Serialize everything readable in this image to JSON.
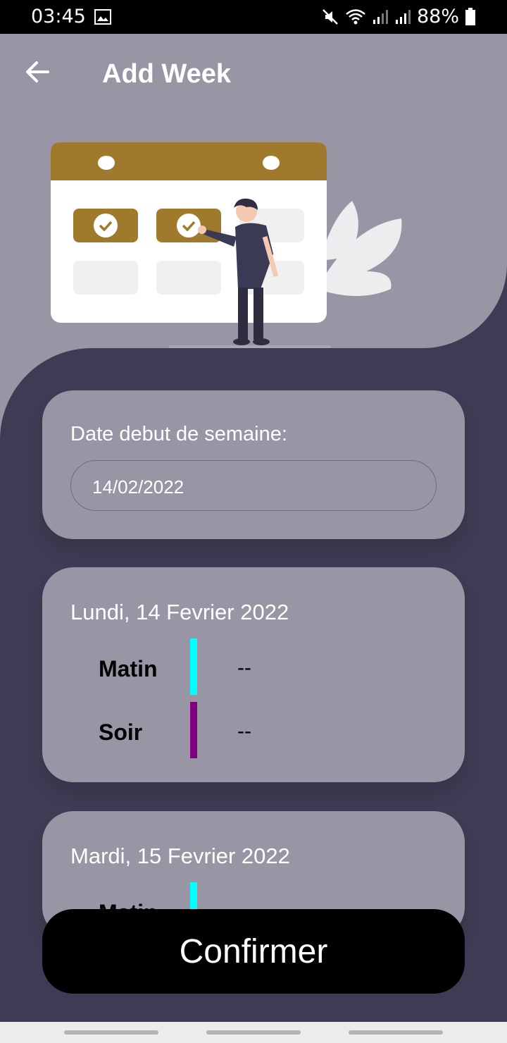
{
  "status": {
    "time": "03:45",
    "battery": "88%"
  },
  "appbar": {
    "title": "Add Week"
  },
  "start_card": {
    "label": "Date debut de semaine:",
    "date_value": "14/02/2022"
  },
  "days": [
    {
      "title": "Lundi, 14 Fevrier 2022",
      "slots": [
        {
          "name": "Matin",
          "value": "--",
          "color": "#00ffff"
        },
        {
          "name": "Soir",
          "value": "--",
          "color": "#800080"
        }
      ]
    },
    {
      "title": "Mardi, 15 Fevrier 2022",
      "slots": [
        {
          "name": "Matin",
          "value": "--",
          "color": "#00ffff"
        }
      ]
    }
  ],
  "confirm_label": "Confirmer",
  "colors": {
    "primary_bg": "#403b54",
    "card_bg": "#9896a4",
    "accent": "#a07a2c"
  }
}
